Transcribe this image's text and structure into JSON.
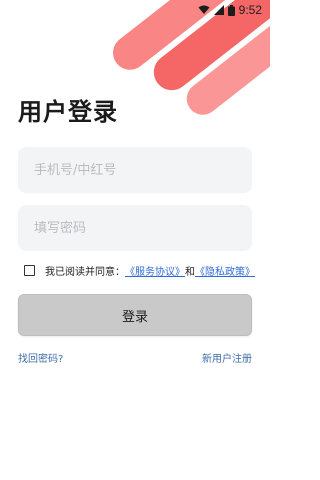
{
  "status_bar": {
    "time": "9:52",
    "icons": [
      "wifi-icon",
      "signal-icon",
      "battery-icon"
    ]
  },
  "page": {
    "title": "用户登录"
  },
  "form": {
    "phone_placeholder": "手机号/中红号",
    "password_placeholder": "填写密码",
    "agree_prefix": "我已阅读并同意：",
    "service_link": "《服务协议》",
    "and_text": "和",
    "privacy_link": "《隐私政策》",
    "agree_checked": false,
    "login_label": "登录"
  },
  "links": {
    "forgot_password": "找回密码?",
    "register": "新用户注册"
  },
  "colors": {
    "accent_red": "#f55a5a",
    "link_blue": "#2f6bd8",
    "field_bg": "#f3f4f6",
    "button_bg": "#c9c9c9"
  }
}
